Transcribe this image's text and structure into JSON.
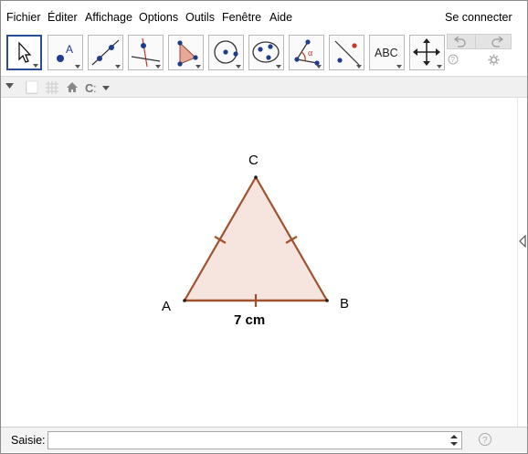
{
  "menu": {
    "items": [
      "Fichier",
      "Éditer",
      "Affichage",
      "Options",
      "Outils",
      "Fenêtre",
      "Aide"
    ],
    "sign_in": "Se connecter"
  },
  "toolbar": {
    "tools": [
      {
        "name": "move-tool",
        "icon": "arrow-cursor-icon",
        "selected": true
      },
      {
        "name": "point-tool",
        "icon": "point-icon",
        "label": "A"
      },
      {
        "name": "line-tool",
        "icon": "line-through-two-points-icon"
      },
      {
        "name": "perpendicular-tool",
        "icon": "perpendicular-line-icon"
      },
      {
        "name": "polygon-tool",
        "icon": "polygon-icon"
      },
      {
        "name": "circle-tool",
        "icon": "circle-center-point-icon"
      },
      {
        "name": "conic-tool",
        "icon": "ellipse-icon"
      },
      {
        "name": "angle-tool",
        "icon": "angle-icon",
        "label": "α"
      },
      {
        "name": "reflect-tool",
        "icon": "reflect-about-line-icon"
      },
      {
        "name": "text-tool",
        "icon": "text-icon",
        "label": "ABC"
      },
      {
        "name": "move-graphics-tool",
        "icon": "move-graphics-view-icon"
      }
    ],
    "undo_icon": "undo-icon",
    "redo_icon": "redo-icon",
    "help_icon": "help-icon",
    "settings_icon": "gear-icon"
  },
  "stylebar": {
    "icons": [
      "toggle-stylebar-icon",
      "axes-icon",
      "grid-icon",
      "home-icon",
      "point-capturing-icon"
    ]
  },
  "graphics": {
    "points": {
      "A": "A",
      "B": "B",
      "C": "C"
    },
    "segment_label": "7 cm",
    "colors": {
      "triangle_stroke": "#a0522d",
      "triangle_fill": "#f6e4de",
      "point": "#1a1a1a"
    }
  },
  "input_bar": {
    "label": "Saisie:",
    "value": "",
    "placeholder": ""
  }
}
